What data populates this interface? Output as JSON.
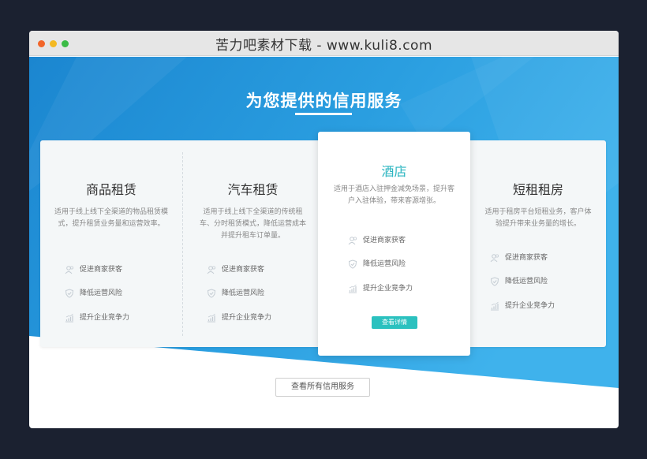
{
  "window": {
    "title": "苦力吧素材下载 - www.kuli8.com"
  },
  "section": {
    "title": "为您提供的信用服务"
  },
  "cards": [
    {
      "title": "商品租赁",
      "description": "适用于线上线下全渠道的物品租赁模式，提升租赁业务量和运营效率。",
      "features": [
        "促进商家获客",
        "降低运营风险",
        "提升企业竞争力"
      ]
    },
    {
      "title": "汽车租赁",
      "description": "适用于线上线下全渠道的传统租车、分时租赁模式，降低运营成本并提升租车订单量。",
      "features": [
        "促进商家获客",
        "降低运营风险",
        "提升企业竞争力"
      ]
    },
    {
      "title": "酒店",
      "description": "适用于酒店入驻押金减免场景，提升客户入驻体验，带来客源增张。",
      "features": [
        "促进商家获客",
        "降低运营风险",
        "提升企业竞争力"
      ],
      "button": "查看详情"
    },
    {
      "title": "短租租房",
      "description": "适用于租房平台短租业务，客户体验提升带来业务量的增长。",
      "features": [
        "促进商家获客",
        "降低运营风险",
        "提升企业竞争力"
      ]
    }
  ],
  "footer": {
    "button": "查看所有信用服务"
  },
  "colors": {
    "accent": "#2bc1bf",
    "hero_blue": "#1d8fd6",
    "featured_title": "#2ab5c0"
  },
  "icons": [
    "user-group-icon",
    "shield-check-icon",
    "chart-growth-icon"
  ]
}
